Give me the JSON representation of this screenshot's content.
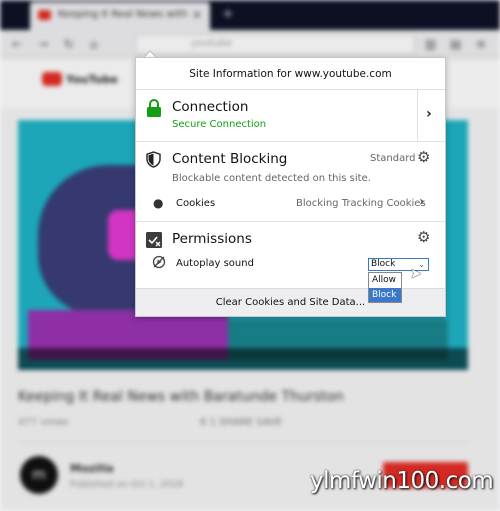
{
  "browser": {
    "tab_title": "Keeping It Real News with Ba",
    "url_host": "youtube"
  },
  "youtube": {
    "logo_text": "YouTube",
    "video_title": "Keeping It Real News with Baratunde Thurston",
    "views": "477 views",
    "actions": "6   1   SHARE   SAVE",
    "channel_avatar": "m",
    "channel_name": "Mozilla",
    "channel_date": "Published on Oct 1, 2018"
  },
  "panel": {
    "header": "Site Information for www.youtube.com",
    "connection": {
      "title": "Connection",
      "status": "Secure Connection",
      "status_color": "#12a012"
    },
    "content_blocking": {
      "title": "Content Blocking",
      "mode": "Standard",
      "detail": "Blockable content detected on this site.",
      "cookies_label": "Cookies",
      "cookies_value": "Blocking Tracking Cookies"
    },
    "permissions": {
      "title": "Permissions",
      "autoplay_label": "Autoplay sound",
      "selected": "Block",
      "options": [
        "Allow",
        "Block"
      ],
      "highlighted_option": "Block"
    },
    "footer_button": "Clear Cookies and Site Data..."
  },
  "watermark": "ylmfwin100.com",
  "colors": {
    "accent": "#3c78c8",
    "secure": "#12a012",
    "youtube_red": "#e52d27"
  },
  "icons": [
    "lock-icon",
    "shield-icon",
    "cookie-icon",
    "permissions-icon",
    "autoplay-icon",
    "gear-icon",
    "chevron-right-icon"
  ]
}
